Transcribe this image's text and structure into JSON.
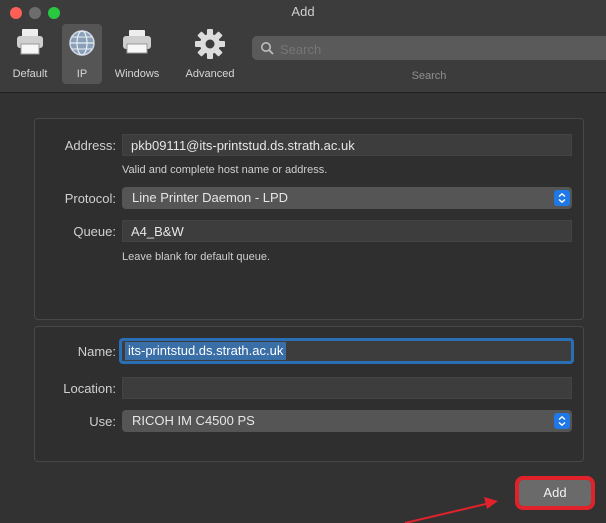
{
  "window": {
    "title": "Add"
  },
  "toolbar": {
    "items": [
      {
        "label": "Default",
        "icon": "printer-icon",
        "selected": false
      },
      {
        "label": "IP",
        "icon": "globe-icon",
        "selected": true
      },
      {
        "label": "Windows",
        "icon": "printer-icon",
        "selected": false
      },
      {
        "label": "Advanced",
        "icon": "gear-icon",
        "selected": false
      }
    ],
    "search": {
      "placeholder": "Search",
      "label": "Search"
    }
  },
  "form": {
    "address": {
      "label": "Address:",
      "value": "pkb09111@its-printstud.ds.strath.ac.uk",
      "hint": "Valid and complete host name or address."
    },
    "protocol": {
      "label": "Protocol:",
      "value": "Line Printer Daemon - LPD"
    },
    "queue": {
      "label": "Queue:",
      "value": "A4_B&W",
      "hint": "Leave blank for default queue."
    },
    "name": {
      "label": "Name:",
      "value": "its-printstud.ds.strath.ac.uk"
    },
    "location": {
      "label": "Location:",
      "value": ""
    },
    "use": {
      "label": "Use:",
      "value": "RICOH IM C4500 PS"
    }
  },
  "actions": {
    "add_label": "Add"
  },
  "colors": {
    "highlight": "#e0222a",
    "accent": "#1f78e6"
  }
}
